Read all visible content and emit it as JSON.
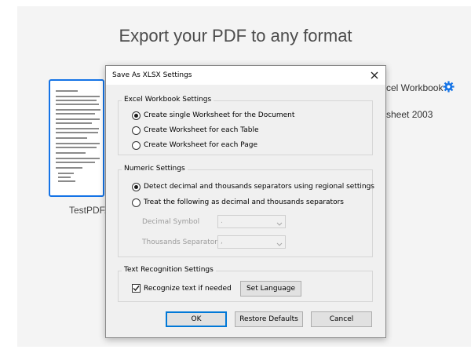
{
  "background": {
    "title": "Export your PDF to any format",
    "thumbnail_label": "TestPDF.p",
    "format_option_1": "cel Workbook",
    "format_option_2": "sheet 2003"
  },
  "dialog": {
    "title": "Save As XLSX Settings",
    "excel_group": {
      "legend": "Excel Workbook Settings",
      "options": [
        {
          "label": "Create single Worksheet for the Document",
          "selected": true
        },
        {
          "label": "Create Worksheet for each Table",
          "selected": false
        },
        {
          "label": "Create Worksheet for each Page",
          "selected": false
        }
      ]
    },
    "numeric_group": {
      "legend": "Numeric Settings",
      "options": [
        {
          "label": "Detect decimal and thousands separators using regional settings",
          "selected": true
        },
        {
          "label": "Treat the following as decimal and thousands separators",
          "selected": false
        }
      ],
      "decimal_symbol_label": "Decimal Symbol",
      "decimal_symbol_value": ".",
      "thousands_separator_label": "Thousands Separator",
      "thousands_separator_value": ","
    },
    "text_group": {
      "legend": "Text Recognition Settings",
      "recognize_label": "Recognize text if needed",
      "recognize_checked": true,
      "set_language_label": "Set Language"
    },
    "buttons": {
      "ok": "OK",
      "restore": "Restore Defaults",
      "cancel": "Cancel"
    }
  },
  "colors": {
    "accent": "#1473e6",
    "default_button_border": "#0078d7"
  },
  "icons": {
    "settings": "gear-icon",
    "close": "close-icon"
  }
}
